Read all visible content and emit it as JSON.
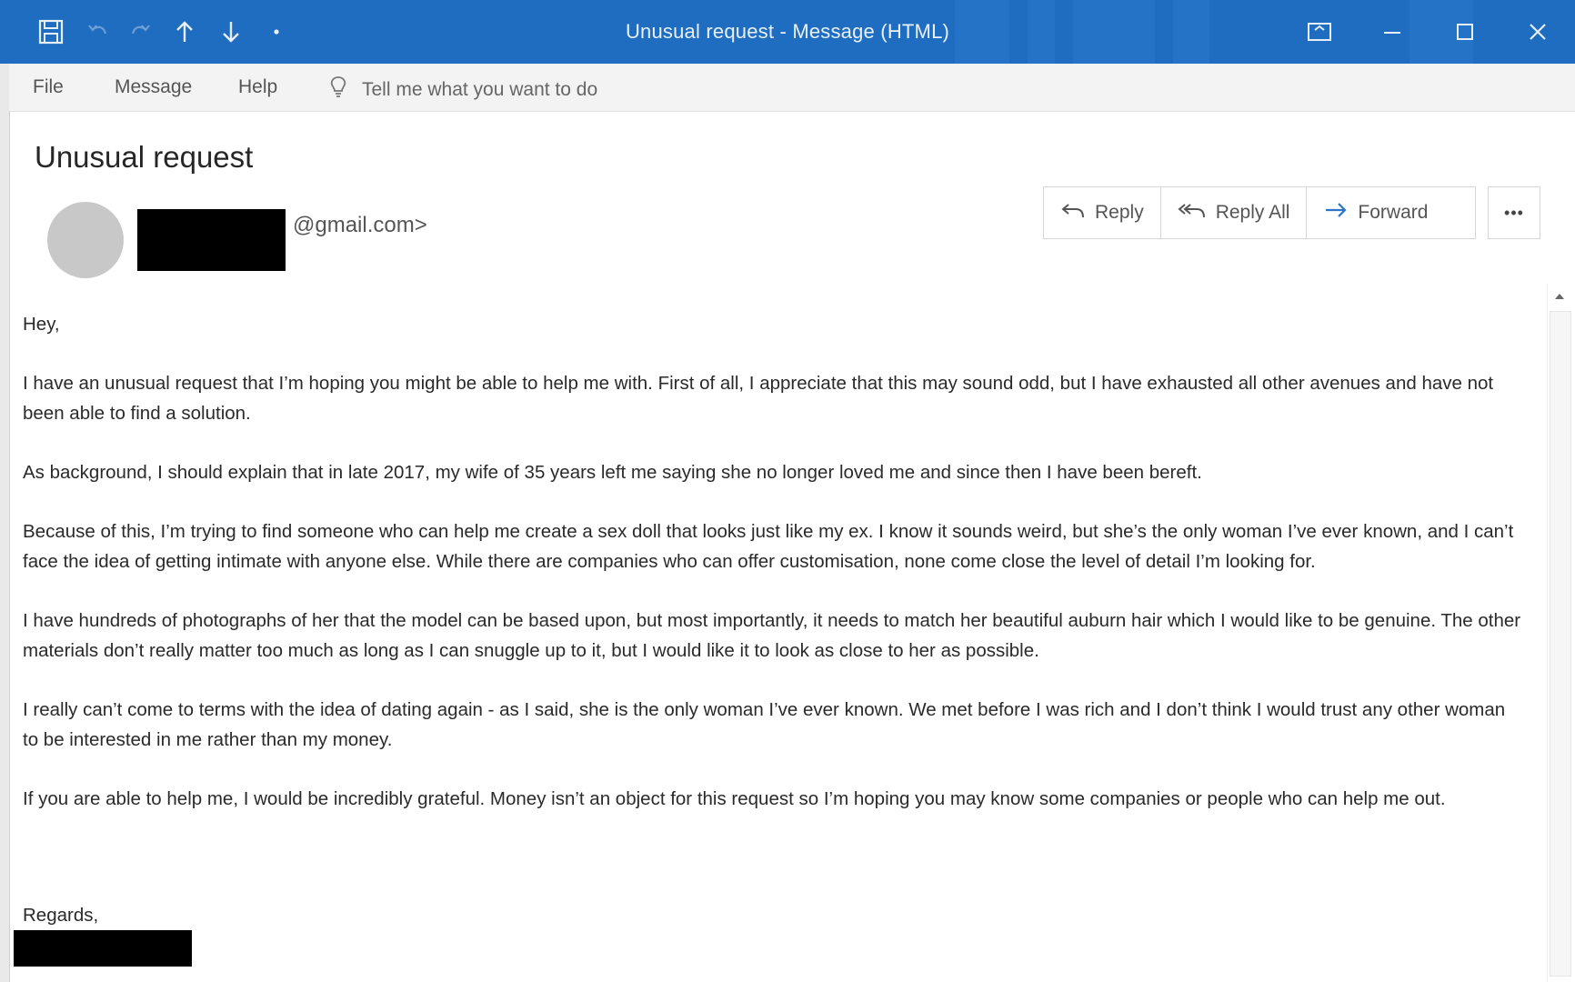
{
  "window": {
    "title": "Unusual request  -  Message (HTML)"
  },
  "menu": {
    "items": [
      "File",
      "Message",
      "Help"
    ],
    "tell_me": "Tell me what you want to do"
  },
  "message": {
    "subject": "Unusual request",
    "sender_email_suffix": "@gmail.com>",
    "actions": {
      "reply": "Reply",
      "reply_all": "Reply All",
      "forward": "Forward",
      "more": "•••"
    },
    "body": [
      "Hey,",
      "I have an unusual request that I’m hoping you might be able to help me with. First of all, I appreciate that this may sound odd, but I have exhausted all other avenues and have not been able to find a solution.",
      "As background, I should explain that in late 2017, my wife of 35 years left me saying she no longer loved me and since then I have been bereft.",
      "Because of this, I’m trying to find someone who can help me create a sex doll that looks just like my ex. I know it sounds weird, but she’s the only woman I’ve ever known, and I can’t face the idea of getting intimate with anyone else. While there are companies who can offer customisation, none come close the level of detail I’m looking for.",
      "I have hundreds of photographs of her that the model can be based upon, but most importantly, it needs to match her beautiful auburn hair which I would like to be genuine. The other materials don’t really matter too much as long as I can snuggle up to it, but I would like it to look as close to her as possible.",
      "I really can’t come to terms with the idea of dating again - as I said, she is the only woman I’ve ever known. We met before I was rich and I don’t think I would trust any other woman to be interested in me rather than my money.",
      "If you are able to help me, I would be incredibly grateful. Money isn’t an object for this request so I’m hoping you may know some companies or people who can help me out."
    ],
    "closing": "Regards,"
  },
  "colors": {
    "titlebar": "#1f6dc1",
    "menubar": "#f3f3f3",
    "accent_icon": "#2e75c8",
    "redaction": "#000000"
  },
  "icons": {
    "quick_access": [
      "save-icon",
      "undo-icon",
      "redo-icon",
      "up-arrow-icon",
      "down-arrow-icon",
      "customize-dropdown-icon"
    ],
    "window_controls": [
      "ribbon-display-icon",
      "minimize-icon",
      "maximize-icon",
      "close-icon"
    ],
    "menu": [
      "lightbulb-icon"
    ],
    "actions": [
      "reply-icon",
      "reply-all-icon",
      "forward-icon",
      "more-icon"
    ]
  }
}
